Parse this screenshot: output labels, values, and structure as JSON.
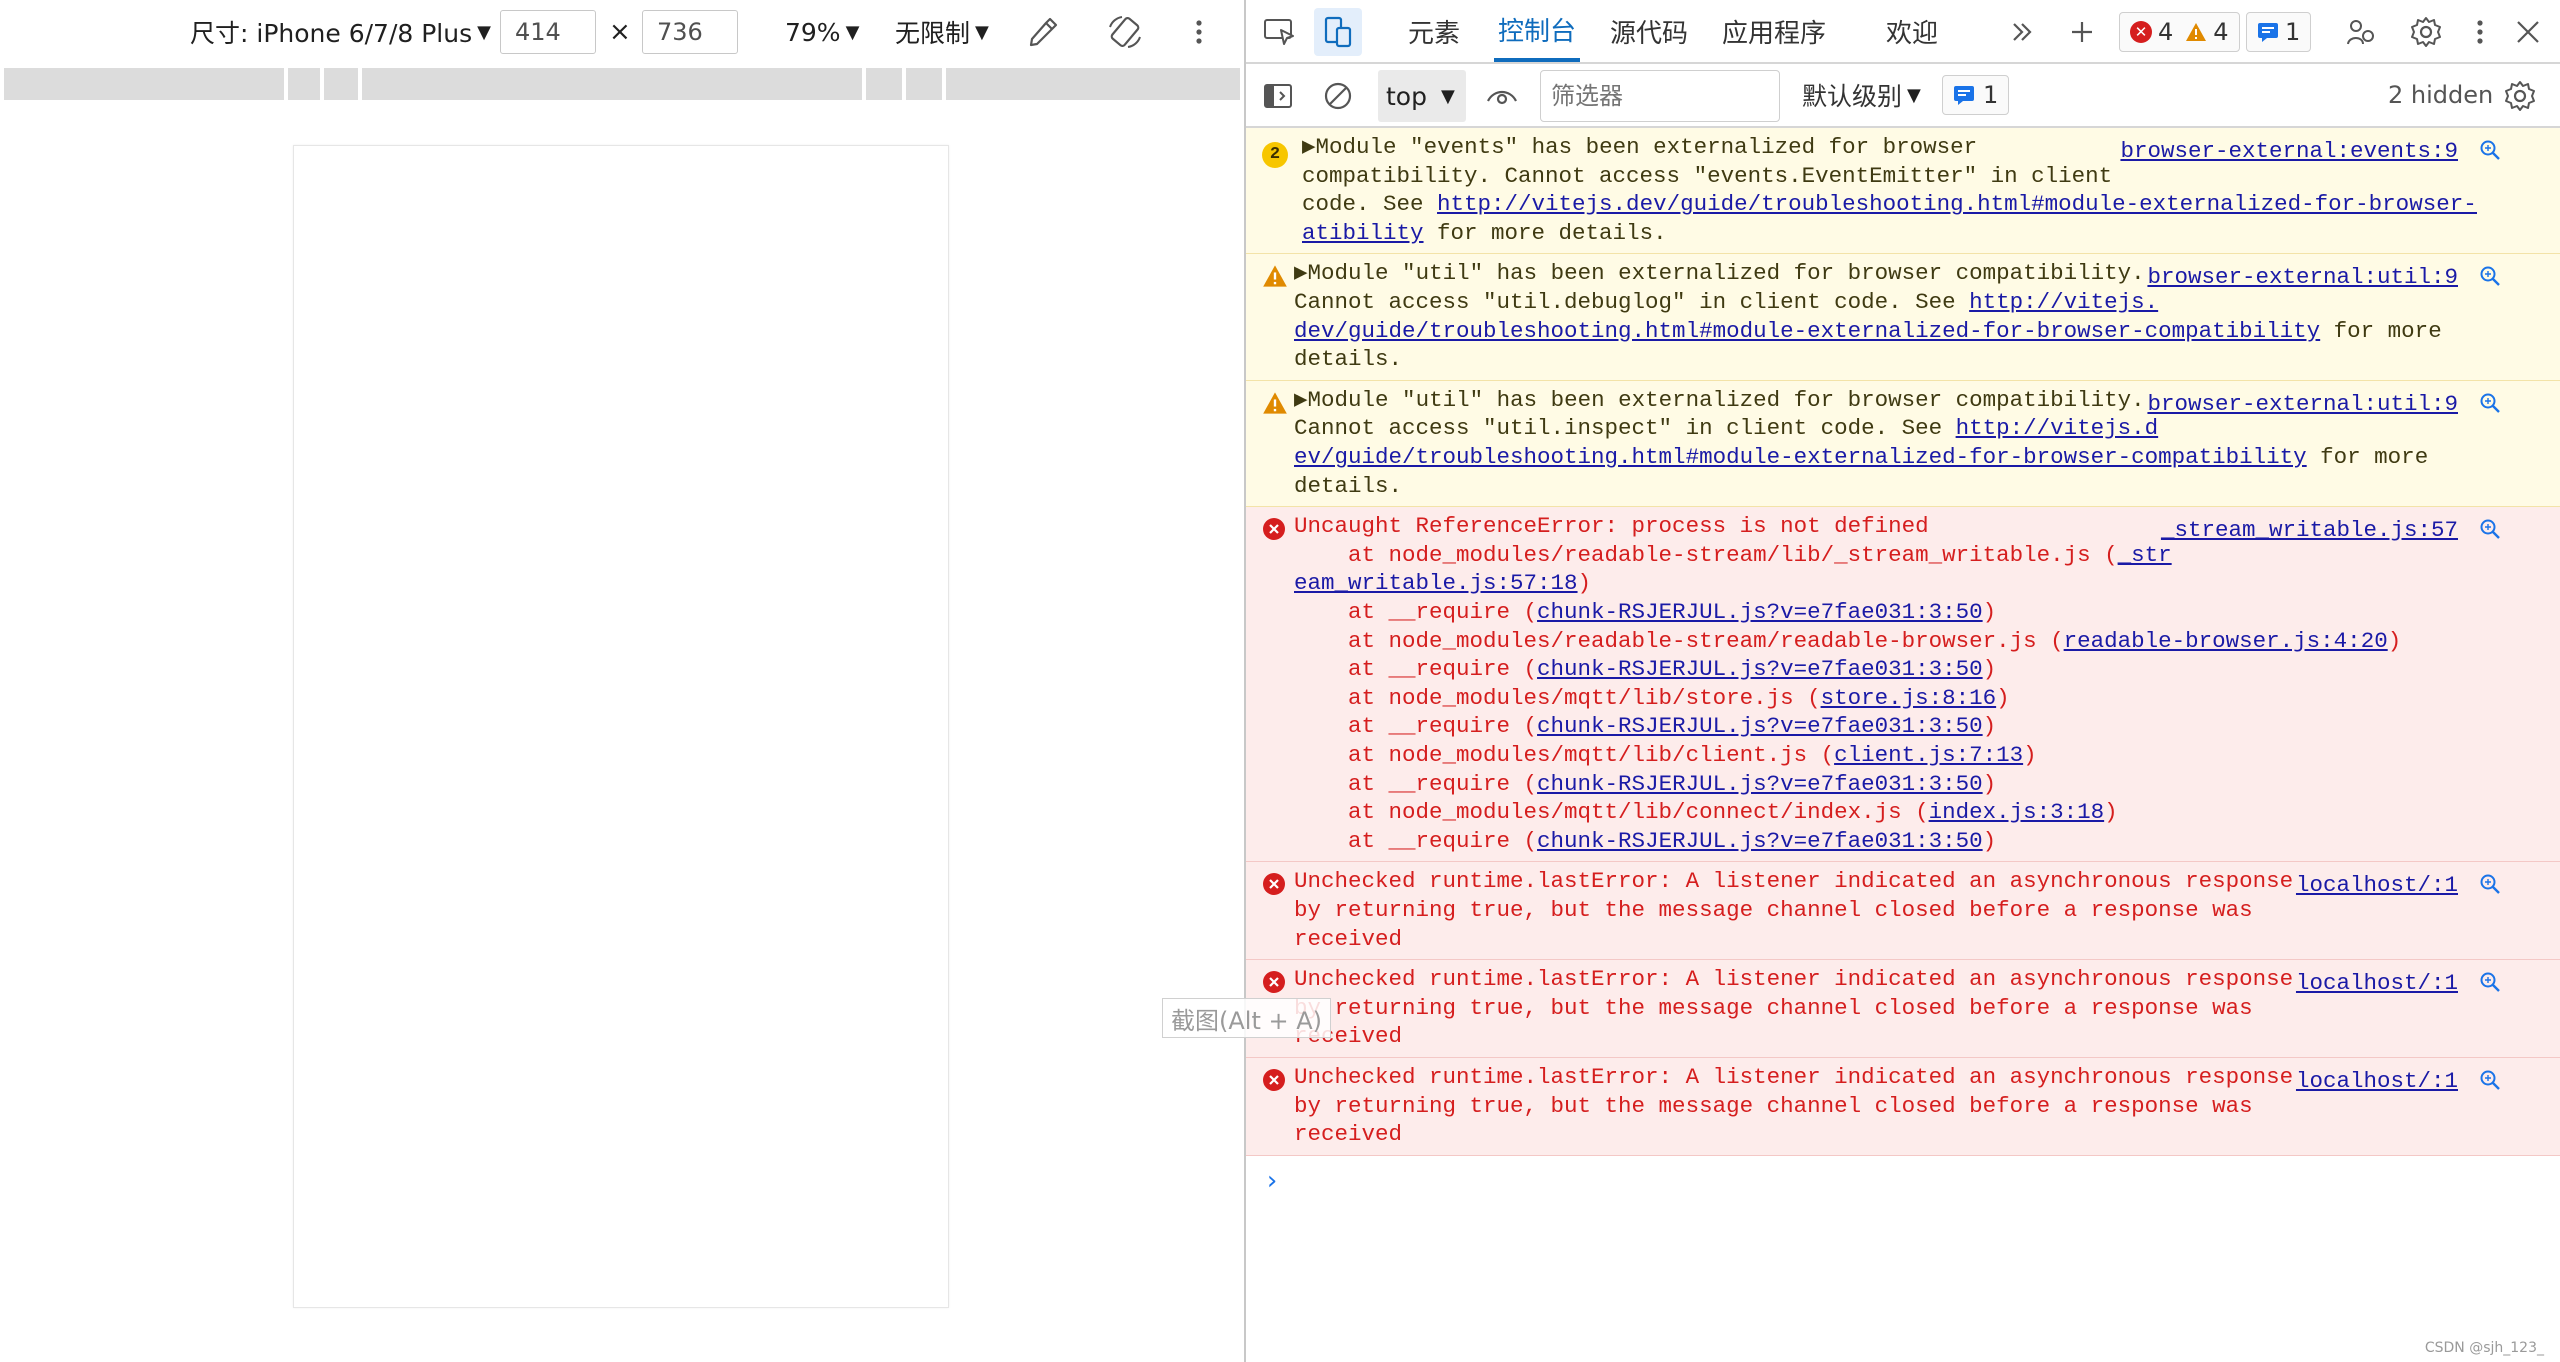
{
  "device_toolbar": {
    "dimensions_label": "尺寸: iPhone 6/7/8 Plus",
    "width": "414",
    "times": "×",
    "height": "736",
    "zoom": "79%",
    "throttle": "无限制"
  },
  "screenshot_tooltip": "截图(Alt + A)",
  "devtools": {
    "tabs": [
      "元素",
      "控制台",
      "源代码",
      "应用程序",
      "欢迎"
    ],
    "active_tab": "控制台",
    "counts": {
      "errors": "4",
      "warnings": "4",
      "info": "1"
    },
    "filter_bar": {
      "context": "top",
      "filter_placeholder": "筛选器",
      "level": "默认级别",
      "info_count": "1",
      "hidden": "2 hidden"
    },
    "messages": [
      {
        "type": "warn",
        "repeat": "2",
        "source": "browser-external:events:9",
        "lines": [
          [
            "▶Module \"events\" has been externalized for browser"
          ],
          [
            "compatibility. Cannot access \"events.EventEmitter\" in client"
          ],
          [
            "code. See ",
            {
              "link": "http://vitejs.dev/guide/troubleshooting.html#module-externalized-for-browser-comp"
            }
          ],
          [
            {
              "link": "atibility"
            },
            " for more details."
          ]
        ]
      },
      {
        "type": "warn",
        "source": "browser-external:util:9",
        "lines": [
          [
            "▶Module \"util\" has been externalized for browser compatibility."
          ],
          [
            "Cannot access \"util.debuglog\" in client code. See ",
            {
              "link": "http://vitejs."
            }
          ],
          [
            {
              "link": "dev/guide/troubleshooting.html#module-externalized-for-browser-compatibility"
            },
            " for more"
          ],
          [
            "details."
          ]
        ]
      },
      {
        "type": "warn",
        "source": "browser-external:util:9",
        "lines": [
          [
            "▶Module \"util\" has been externalized for browser compatibility."
          ],
          [
            "Cannot access \"util.inspect\" in client code. See ",
            {
              "link": "http://vitejs.d"
            }
          ],
          [
            {
              "link": "ev/guide/troubleshooting.html#module-externalized-for-browser-compatibility"
            },
            " for more"
          ],
          [
            "details."
          ]
        ]
      },
      {
        "type": "error",
        "source": "_stream_writable.js:57",
        "lines": [
          [
            "Uncaught ReferenceError: process is not defined"
          ],
          [
            "    at node_modules/readable-stream/lib/_stream_writable.js (",
            {
              "link": "_str"
            }
          ],
          [
            {
              "link": "eam_writable.js:57:18"
            },
            ")"
          ],
          [
            "    at __require (",
            {
              "link": "chunk-RSJERJUL.js?v=e7fae031:3:50"
            },
            ")"
          ],
          [
            "    at node_modules/readable-stream/readable-browser.js (",
            {
              "link": "readable-browser.js:4:20"
            },
            ")"
          ],
          [
            "    at __require (",
            {
              "link": "chunk-RSJERJUL.js?v=e7fae031:3:50"
            },
            ")"
          ],
          [
            "    at node_modules/mqtt/lib/store.js (",
            {
              "link": "store.js:8:16"
            },
            ")"
          ],
          [
            "    at __require (",
            {
              "link": "chunk-RSJERJUL.js?v=e7fae031:3:50"
            },
            ")"
          ],
          [
            "    at node_modules/mqtt/lib/client.js (",
            {
              "link": "client.js:7:13"
            },
            ")"
          ],
          [
            "    at __require (",
            {
              "link": "chunk-RSJERJUL.js?v=e7fae031:3:50"
            },
            ")"
          ],
          [
            "    at node_modules/mqtt/lib/connect/index.js (",
            {
              "link": "index.js:3:18"
            },
            ")"
          ],
          [
            "    at __require (",
            {
              "link": "chunk-RSJERJUL.js?v=e7fae031:3:50"
            },
            ")"
          ]
        ]
      },
      {
        "type": "error",
        "source": "localhost/:1",
        "lines": [
          [
            "Unchecked runtime.lastError: A listener indicated an asynchronous response"
          ],
          [
            "by returning true, but the message channel closed before a response was"
          ],
          [
            "received"
          ]
        ]
      },
      {
        "type": "error",
        "source": "localhost/:1",
        "lines": [
          [
            "Unchecked runtime.lastError: A listener indicated an asynchronous response"
          ],
          [
            "by returning true, but the message channel closed before a response was"
          ],
          [
            "received"
          ]
        ]
      },
      {
        "type": "error",
        "source": "localhost/:1",
        "lines": [
          [
            "Unchecked runtime.lastError: A listener indicated an asynchronous response"
          ],
          [
            "by returning true, but the message channel closed before a response was"
          ],
          [
            "received"
          ]
        ]
      }
    ],
    "prompt": "›"
  },
  "watermark": "CSDN @sjh_123_",
  "colors": {
    "accent": "#0f6cbd",
    "error": "#d51e1e",
    "warning": "#e08a00",
    "info": "#1a73e8",
    "link": "#1a1aa6"
  }
}
